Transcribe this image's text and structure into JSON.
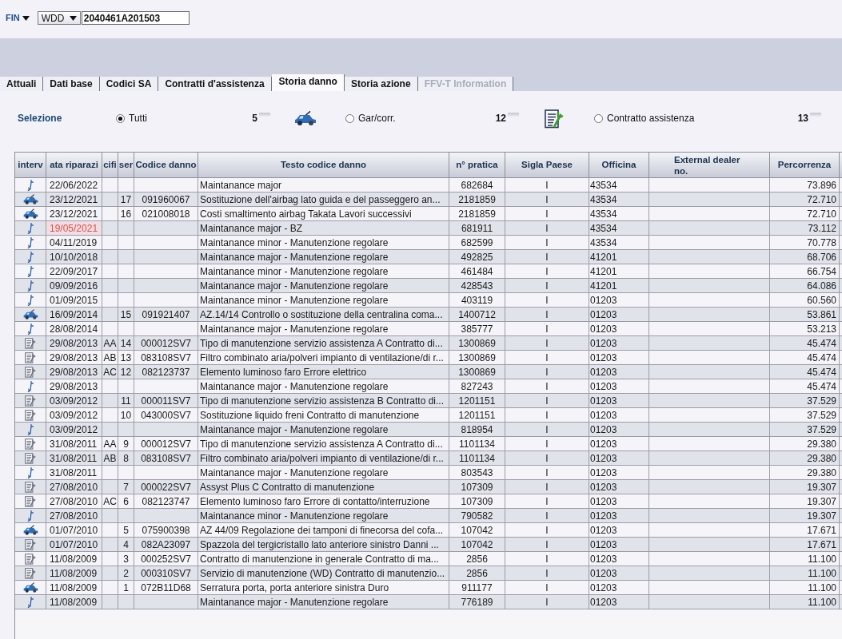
{
  "header": {
    "id_type": {
      "label": "FIN"
    },
    "prefix": {
      "value": "WDD"
    },
    "vin": {
      "value": "2040461A201503"
    }
  },
  "tabs": [
    {
      "label": "Attuali",
      "selected": false,
      "disabled": false
    },
    {
      "label": "Dati base",
      "selected": false,
      "disabled": false
    },
    {
      "label": "Codici SA",
      "selected": false,
      "disabled": false
    },
    {
      "label": "Contratti d'assistenza",
      "selected": false,
      "disabled": false
    },
    {
      "label": "Storia danno",
      "selected": true,
      "disabled": false
    },
    {
      "label": "Storia azione",
      "selected": false,
      "disabled": false
    },
    {
      "label": "FFV-T Information",
      "selected": false,
      "disabled": true
    }
  ],
  "selection": {
    "label": "Selezione",
    "options": [
      {
        "label": "Tutti",
        "selected": true,
        "count": "5",
        "kind": "car"
      },
      {
        "label": "Gar/corr.",
        "selected": false,
        "count": "12",
        "kind": "contract"
      },
      {
        "label": "Contratto assistenza",
        "selected": false,
        "count": "13",
        "kind": "plain"
      }
    ]
  },
  "table": {
    "columns": [
      {
        "label": "interv"
      },
      {
        "label": "ata riparazi"
      },
      {
        "label": "cifi"
      },
      {
        "label": "ser"
      },
      {
        "label": "Codice danno"
      },
      {
        "label": "Testo codice danno"
      },
      {
        "label": "n° pratica"
      },
      {
        "label": "Sigla Paese"
      },
      {
        "label": "Officina"
      },
      {
        "label": "External dealer no."
      },
      {
        "label": "Percorrenza"
      }
    ],
    "rows": [
      {
        "kind": "maintenance",
        "flagged": false,
        "date": "22/06/2022",
        "testo": "Maintanance major",
        "n_pratica": "682684",
        "sigla_paese": "I",
        "officina": "43534",
        "percorrenza": "73.896"
      },
      {
        "kind": "car",
        "flagged": false,
        "date": "23/12/2021",
        "column_4": "17",
        "codice_danno": "091960067",
        "testo": "Sostituzione dell'airbag lato guida e del passeggero an...",
        "n_pratica": "2181859",
        "sigla_paese": "I",
        "officina": "43534",
        "percorrenza": "72.710"
      },
      {
        "kind": "car",
        "flagged": false,
        "date": "23/12/2021",
        "column_4": "16",
        "codice_danno": "021008018",
        "testo": "Costi smaltimento airbag Takata Lavori successivi",
        "n_pratica": "2181859",
        "sigla_paese": "I",
        "officina": "43534",
        "percorrenza": "72.710"
      },
      {
        "kind": "maintenance",
        "flagged": true,
        "date": "19/05/2021",
        "testo": "Maintanance major - BZ",
        "n_pratica": "681911",
        "sigla_paese": "I",
        "officina": "43534",
        "percorrenza": "73.112"
      },
      {
        "kind": "maintenance",
        "flagged": false,
        "date": "04/11/2019",
        "testo": "Maintanance minor - Manutenzione regolare",
        "n_pratica": "682599",
        "sigla_paese": "I",
        "officina": "43534",
        "percorrenza": "70.778"
      },
      {
        "kind": "maintenance",
        "flagged": false,
        "date": "10/10/2018",
        "testo": "Maintanance major - Manutenzione regolare",
        "n_pratica": "492825",
        "sigla_paese": "I",
        "officina": "41201",
        "percorrenza": "68.706"
      },
      {
        "kind": "maintenance",
        "flagged": false,
        "date": "22/09/2017",
        "testo": "Maintanance minor - Manutenzione regolare",
        "n_pratica": "461484",
        "sigla_paese": "I",
        "officina": "41201",
        "percorrenza": "66.754"
      },
      {
        "kind": "maintenance",
        "flagged": false,
        "date": "09/09/2016",
        "testo": "Maintanance major - Manutenzione regolare",
        "n_pratica": "428543",
        "sigla_paese": "I",
        "officina": "41201",
        "percorrenza": "64.086"
      },
      {
        "kind": "maintenance",
        "flagged": false,
        "date": "01/09/2015",
        "testo": "Maintanance minor - Manutenzione regolare",
        "n_pratica": "403119",
        "sigla_paese": "I",
        "officina": "01203",
        "percorrenza": "60.560"
      },
      {
        "kind": "car",
        "flagged": false,
        "date": "16/09/2014",
        "column_4": "15",
        "codice_danno": "091921407",
        "testo": "AZ.14/14 Controllo o sostituzione della centralina coma...",
        "n_pratica": "1400712",
        "sigla_paese": "I",
        "officina": "01203",
        "percorrenza": "53.861"
      },
      {
        "kind": "maintenance",
        "flagged": false,
        "date": "28/08/2014",
        "testo": "Maintanance major - Manutenzione regolare",
        "n_pratica": "385777",
        "sigla_paese": "I",
        "officina": "01203",
        "percorrenza": "53.213"
      },
      {
        "kind": "contract",
        "flagged": false,
        "date": "29/08/2013",
        "column_3": "AA",
        "column_4": "14",
        "codice_danno": "000012SV7",
        "testo": "Tipo di manutenzione servizio assistenza A Contratto di...",
        "n_pratica": "1300869",
        "sigla_paese": "I",
        "officina": "01203",
        "percorrenza": "45.474"
      },
      {
        "kind": "contract",
        "flagged": false,
        "date": "29/08/2013",
        "column_3": "AB",
        "column_4": "13",
        "codice_danno": "083108SV7",
        "testo": "Filtro combinato aria/polveri impianto di ventilazione/di r...",
        "n_pratica": "1300869",
        "sigla_paese": "I",
        "officina": "01203",
        "percorrenza": "45.474"
      },
      {
        "kind": "contract",
        "flagged": false,
        "date": "29/08/2013",
        "column_3": "AC",
        "column_4": "12",
        "codice_danno": "082123737",
        "testo": "Elemento luminoso faro Errore elettrico",
        "n_pratica": "1300869",
        "sigla_paese": "I",
        "officina": "01203",
        "percorrenza": "45.474"
      },
      {
        "kind": "maintenance",
        "flagged": false,
        "date": "29/08/2013",
        "testo": "Maintanance major - Manutenzione regolare",
        "n_pratica": "827243",
        "sigla_paese": "I",
        "officina": "01203",
        "percorrenza": "45.474"
      },
      {
        "kind": "contract",
        "flagged": false,
        "date": "03/09/2012",
        "column_4": "11",
        "codice_danno": "000011SV7",
        "testo": "Tipo di manutenzione servizio assistenza B Contratto di...",
        "n_pratica": "1201151",
        "sigla_paese": "I",
        "officina": "01203",
        "percorrenza": "37.529"
      },
      {
        "kind": "contract",
        "flagged": false,
        "date": "03/09/2012",
        "column_4": "10",
        "codice_danno": "043000SV7",
        "testo": "Sostituzione liquido freni Contratto di manutenzione",
        "n_pratica": "1201151",
        "sigla_paese": "I",
        "officina": "01203",
        "percorrenza": "37.529"
      },
      {
        "kind": "maintenance",
        "flagged": false,
        "date": "03/09/2012",
        "testo": "Maintanance major - Manutenzione regolare",
        "n_pratica": "818954",
        "sigla_paese": "I",
        "officina": "01203",
        "percorrenza": "37.529"
      },
      {
        "kind": "contract",
        "flagged": false,
        "date": "31/08/2011",
        "column_3": "AA",
        "column_4": "9",
        "codice_danno": "000012SV7",
        "testo": "Tipo di manutenzione servizio assistenza A Contratto di...",
        "n_pratica": "1101134",
        "sigla_paese": "I",
        "officina": "01203",
        "percorrenza": "29.380"
      },
      {
        "kind": "contract",
        "flagged": false,
        "date": "31/08/2011",
        "column_3": "AB",
        "column_4": "8",
        "codice_danno": "083108SV7",
        "testo": "Filtro combinato aria/polveri impianto di ventilazione/di r...",
        "n_pratica": "1101134",
        "sigla_paese": "I",
        "officina": "01203",
        "percorrenza": "29.380"
      },
      {
        "kind": "maintenance",
        "flagged": false,
        "date": "31/08/2011",
        "testo": "Maintanance major - Manutenzione regolare",
        "n_pratica": "803543",
        "sigla_paese": "I",
        "officina": "01203",
        "percorrenza": "29.380"
      },
      {
        "kind": "contract",
        "flagged": false,
        "date": "27/08/2010",
        "column_4": "7",
        "codice_danno": "000022SV7",
        "testo": "Assyst Plus C Contratto di manutenzione",
        "n_pratica": "107309",
        "sigla_paese": "I",
        "officina": "01203",
        "percorrenza": "19.307"
      },
      {
        "kind": "contract",
        "flagged": false,
        "date": "27/08/2010",
        "column_3": "AC",
        "column_4": "6",
        "codice_danno": "082123747",
        "testo": "Elemento luminoso faro Errore di contatto/interruzione",
        "n_pratica": "107309",
        "sigla_paese": "I",
        "officina": "01203",
        "percorrenza": "19.307"
      },
      {
        "kind": "maintenance",
        "flagged": false,
        "date": "27/08/2010",
        "testo": "Maintanance minor - Manutenzione regolare",
        "n_pratica": "790582",
        "sigla_paese": "I",
        "officina": "01203",
        "percorrenza": "19.307"
      },
      {
        "kind": "car",
        "flagged": false,
        "date": "01/07/2010",
        "column_4": "5",
        "codice_danno": "075900398",
        "testo": "AZ 44/09 Regolazione dei tamponi di finecorsa del cofa...",
        "n_pratica": "107042",
        "sigla_paese": "I",
        "officina": "01203",
        "percorrenza": "17.671"
      },
      {
        "kind": "contract",
        "flagged": false,
        "date": "01/07/2010",
        "column_4": "4",
        "codice_danno": "082A23097",
        "testo": "Spazzola del tergicristallo lato anteriore sinistro Danni ...",
        "n_pratica": "107042",
        "sigla_paese": "I",
        "officina": "01203",
        "percorrenza": "17.671"
      },
      {
        "kind": "contract",
        "flagged": false,
        "date": "11/08/2009",
        "column_4": "3",
        "codice_danno": "000252SV7",
        "testo": "Contratto di manutenzione in generale Contratto di ma...",
        "n_pratica": "2856",
        "sigla_paese": "I",
        "officina": "01203",
        "percorrenza": "11.100"
      },
      {
        "kind": "contract",
        "flagged": false,
        "date": "11/08/2009",
        "column_4": "2",
        "codice_danno": "000310SV7",
        "testo": "Servizio di manutenzione (WD) Contratto di manutenzio...",
        "n_pratica": "2856",
        "sigla_paese": "I",
        "officina": "01203",
        "percorrenza": "11.100"
      },
      {
        "kind": "car",
        "flagged": false,
        "date": "11/08/2009",
        "column_4": "1",
        "codice_danno": "072B11D68",
        "testo": "Serratura porta, porta anteriore sinistra Duro",
        "n_pratica": "911177",
        "sigla_paese": "I",
        "officina": "01203",
        "percorrenza": "11.100"
      },
      {
        "kind": "maintenance",
        "flagged": false,
        "date": "11/08/2009",
        "testo": "Maintanance major - Manutenzione regolare",
        "n_pratica": "776189",
        "sigla_paese": "I",
        "officina": "01203",
        "percorrenza": "11.100"
      }
    ]
  }
}
